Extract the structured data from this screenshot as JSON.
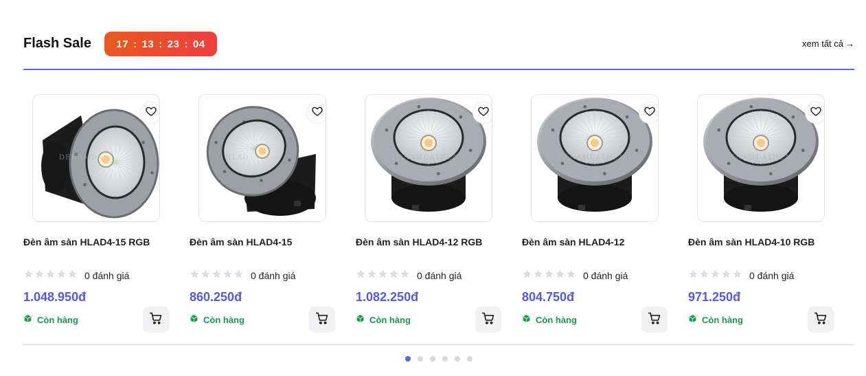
{
  "section": {
    "title": "Flash Sale",
    "see_all": "xem tất cả",
    "see_all_arrow": "→"
  },
  "countdown": {
    "hours": "17",
    "minutes": "13",
    "seconds": "23",
    "ms": "04",
    "separator": ":"
  },
  "products": [
    {
      "name": "Đèn âm sàn HLAD4-15 RGB",
      "rating_count": "0 đánh giá",
      "price": "1.048.950đ",
      "stock": "Còn hàng",
      "watermark": "DENAMDA",
      "view": "tilt-left"
    },
    {
      "name": "Đèn âm sàn HLAD4-15",
      "rating_count": "0 đánh giá",
      "price": "860.250đ",
      "stock": "Còn hàng",
      "watermark": "HLAD",
      "view": "tilt-right"
    },
    {
      "name": "Đèn âm sàn HLAD4-12 RGB",
      "rating_count": "0 đánh giá",
      "price": "1.082.250đ",
      "stock": "Còn hàng",
      "watermark": "DENAMDATHLAD",
      "view": "front"
    },
    {
      "name": "Đèn âm sàn HLAD4-12",
      "rating_count": "0 đánh giá",
      "price": "804.750đ",
      "stock": "Còn hàng",
      "watermark": "DENAMDATHLAD",
      "view": "front"
    },
    {
      "name": "Đèn âm sàn HLAD4-10 RGB",
      "rating_count": "0 đánh giá",
      "price": "971.250đ",
      "stock": "Còn hàng",
      "watermark": "DENAMDATHLAD",
      "view": "front"
    }
  ],
  "pagination": {
    "count": 6,
    "active": 0
  },
  "colors": {
    "accent": "#5767e6",
    "price": "#5459e3",
    "stock": "#1a9b4c",
    "countdown_start": "#e85a1c",
    "countdown_end": "#ef3e3e"
  },
  "icons": {
    "favorite": "heart-icon",
    "cart": "cart-icon",
    "stock": "box-icon",
    "star": "star-icon"
  }
}
